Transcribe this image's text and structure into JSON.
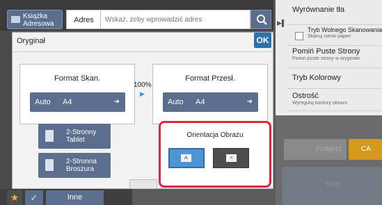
{
  "header": {
    "address_book_label": "Książka Adresowa",
    "address_label": "Adres",
    "address_placeholder": "Wskaż, żeby wprowadzić adres"
  },
  "dialog": {
    "title": "Oryginał",
    "ok_label": "OK",
    "scan_format": {
      "heading": "Format Skan.",
      "mode": "Auto",
      "size": "A4"
    },
    "zoom": "100%",
    "send_format": {
      "heading": "Format Przesł.",
      "mode": "Auto",
      "size": "A4"
    },
    "duplex_tablet_label": "2-Stronny Tablet",
    "duplex_booklet_label": "2-Stronna Broszura",
    "orientation": {
      "heading": "Orientacja Obrazu",
      "portrait_glyph": "A",
      "landscape_glyph": "<"
    }
  },
  "right_panel": {
    "items": [
      {
        "title": "Wyrównanie tła",
        "subtitle": ""
      },
      {
        "title": "Tryb Wolnego Skanowania",
        "subtitle": "Skanuj cienki papier"
      },
      {
        "title": "Pomiń Puste Strony",
        "subtitle": "Pomiń puste strony w oryginale"
      },
      {
        "title": "Tryb Kolorowy",
        "subtitle": ""
      },
      {
        "title": "Ostrość",
        "subtitle": "Wyreguluj kontury obrazu"
      }
    ],
    "preview_label": "Podgląd",
    "ca_label": "CA",
    "start_label": "Start"
  },
  "bottom_bar": {
    "other_label": "Inne"
  },
  "colors": {
    "highlight": "#e0263f",
    "button_blue": "#5b6e8e",
    "ok_blue": "#2f70b0",
    "ca_orange": "#d59a1c"
  }
}
